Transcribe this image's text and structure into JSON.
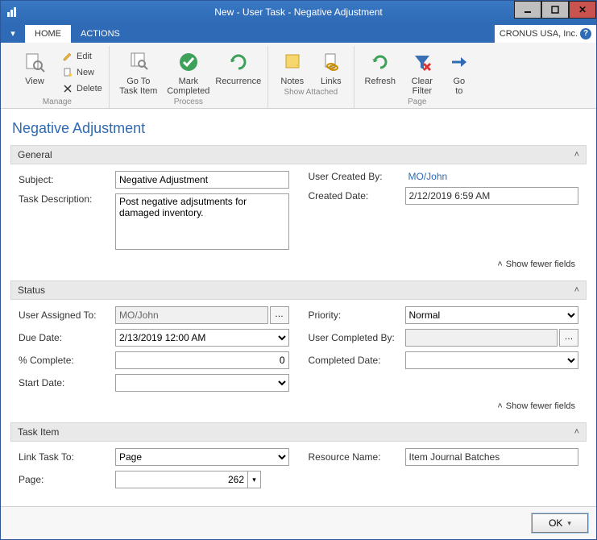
{
  "window": {
    "title": "New - User Task - Negative Adjustment"
  },
  "tabs": {
    "file_glyph": "▾",
    "home": "HOME",
    "actions": "ACTIONS"
  },
  "company": "CRONUS USA, Inc.",
  "ribbon": {
    "manage": {
      "view": "View",
      "edit": "Edit",
      "new": "New",
      "delete": "Delete",
      "group": "Manage"
    },
    "process": {
      "goto_task_item": "Go To\nTask Item",
      "mark_completed": "Mark\nCompleted",
      "recurrence": "Recurrence",
      "group": "Process"
    },
    "show_attached": {
      "notes": "Notes",
      "links": "Links",
      "group": "Show Attached"
    },
    "page": {
      "refresh": "Refresh",
      "clear_filter": "Clear\nFilter",
      "goto": "Go\nto",
      "group": "Page"
    }
  },
  "page_title": "Negative Adjustment",
  "sections": {
    "general": {
      "title": "General",
      "subject_label": "Subject:",
      "subject_value": "Negative Adjustment",
      "task_desc_label": "Task Description:",
      "task_desc_value": "Post negative adjsutments for damaged inventory.",
      "user_created_by_label": "User Created By:",
      "user_created_by_value": "MO/John",
      "created_date_label": "Created Date:",
      "created_date_value": "2/12/2019 6:59 AM",
      "show_fewer": "Show fewer fields"
    },
    "status": {
      "title": "Status",
      "user_assigned_label": "User Assigned To:",
      "user_assigned_value": "MO/John",
      "due_date_label": "Due Date:",
      "due_date_value": "2/13/2019 12:00 AM",
      "pct_complete_label": "% Complete:",
      "pct_complete_value": "0",
      "start_date_label": "Start Date:",
      "start_date_value": "",
      "priority_label": "Priority:",
      "priority_value": "Normal",
      "user_completed_by_label": "User Completed By:",
      "user_completed_by_value": "",
      "completed_date_label": "Completed Date:",
      "completed_date_value": "",
      "show_fewer": "Show fewer fields"
    },
    "task_item": {
      "title": "Task Item",
      "link_task_to_label": "Link Task To:",
      "link_task_to_value": "Page",
      "page_label": "Page:",
      "page_value": "262",
      "resource_name_label": "Resource Name:",
      "resource_name_value": "Item Journal Batches"
    }
  },
  "footer": {
    "ok": "OK"
  }
}
